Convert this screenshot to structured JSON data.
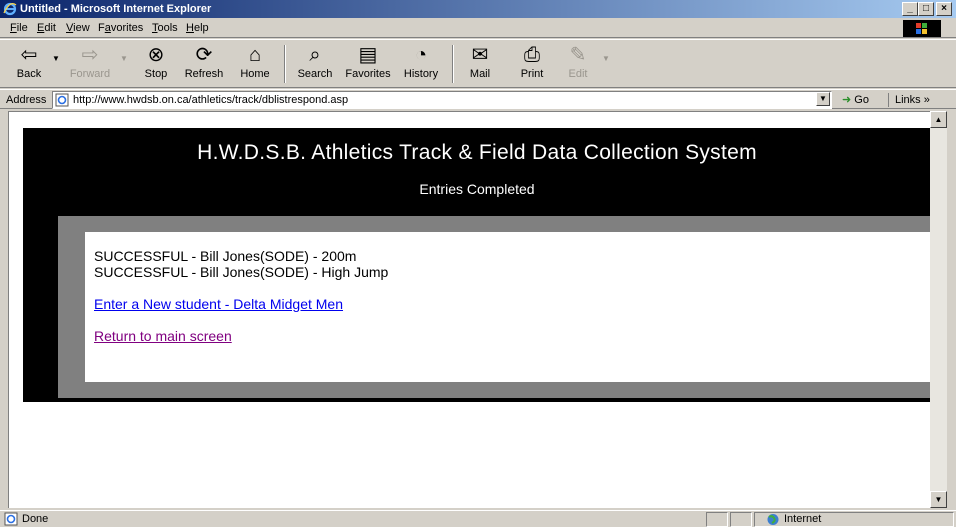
{
  "window": {
    "title": "Untitled - Microsoft Internet Explorer",
    "buttons": {
      "minimize": "_",
      "maximize": "□",
      "close": "×"
    }
  },
  "menu": [
    {
      "label": "File",
      "accel": "F",
      "rest": "ile"
    },
    {
      "label": "Edit",
      "accel": "E",
      "rest": "dit"
    },
    {
      "label": "View",
      "accel": "V",
      "rest": "iew"
    },
    {
      "label": "Favorites",
      "pre": "F",
      "accel": "a",
      "rest": "vorites"
    },
    {
      "label": "Tools",
      "accel": "T",
      "rest": "ools"
    },
    {
      "label": "Help",
      "accel": "H",
      "rest": "elp"
    }
  ],
  "toolbar": {
    "back": "Back",
    "forward": "Forward",
    "stop": "Stop",
    "refresh": "Refresh",
    "home": "Home",
    "search": "Search",
    "favorites": "Favorites",
    "history": "History",
    "mail": "Mail",
    "print": "Print",
    "edit": "Edit"
  },
  "address": {
    "label": "Address",
    "url": "http://www.hwdsb.on.ca/athletics/track/dblistrespond.asp",
    "go": "Go",
    "links": "Links »"
  },
  "page": {
    "title": "H.W.D.S.B. Athletics Track & Field Data Collection System",
    "subtitle": "Entries Completed",
    "results": [
      "SUCCESSFUL - Bill Jones(SODE) - 200m",
      "SUCCESSFUL - Bill Jones(SODE) - High Jump"
    ],
    "new_student_link": "Enter a New student - Delta Midget Men",
    "return_link": "Return to main screen"
  },
  "status": {
    "text": "Done",
    "zone": "Internet"
  },
  "colors": {
    "titlebar_start": "#0a246a",
    "titlebar_end": "#a6caf0",
    "chrome": "#d4d0c8",
    "link": "#0000ee",
    "visited_link": "#800080",
    "panel_black": "#000000",
    "panel_grey": "#808080"
  }
}
